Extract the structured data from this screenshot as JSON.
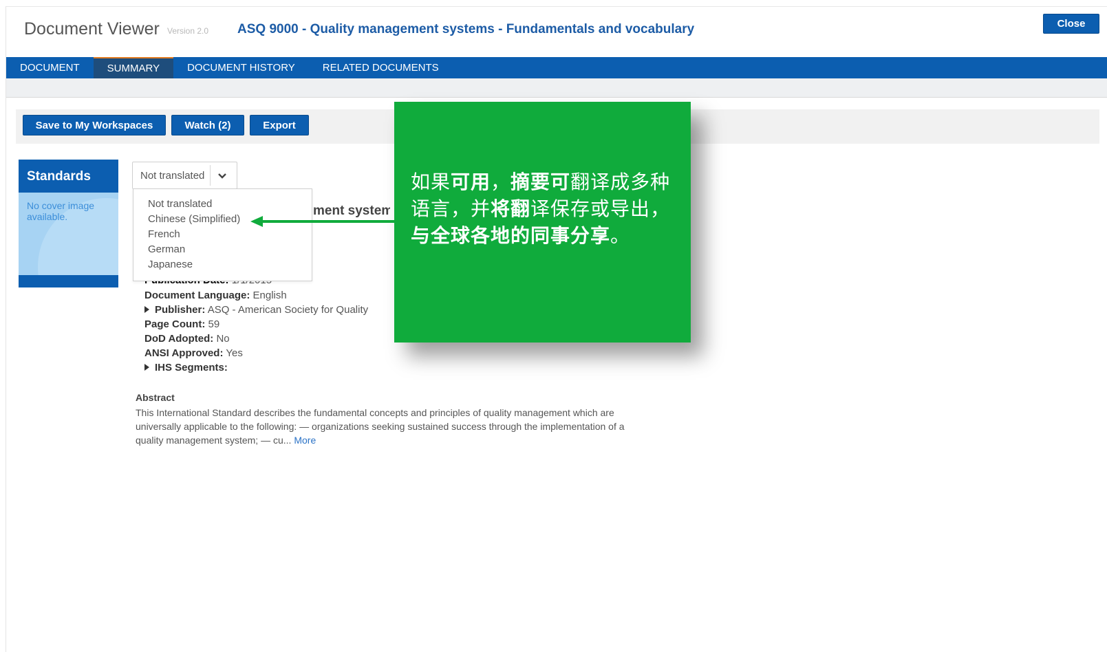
{
  "header": {
    "app_title": "Document Viewer",
    "version": "Version 2.0",
    "doc_title": "ASQ 9000 - Quality management systems - Fundamentals and vocabulary",
    "close_label": "Close"
  },
  "tabs": [
    {
      "label": "DOCUMENT",
      "active": false
    },
    {
      "label": "SUMMARY",
      "active": true
    },
    {
      "label": "DOCUMENT HISTORY",
      "active": false
    },
    {
      "label": "RELATED DOCUMENTS",
      "active": false
    }
  ],
  "actions": {
    "save_label": "Save to My Workspaces",
    "watch_label": "Watch (2)",
    "export_label": "Export"
  },
  "sidebar": {
    "heading": "Standards",
    "cover_note": "No cover image available."
  },
  "translation": {
    "selected": "Not translated",
    "options": [
      "Not translated",
      "Chinese (Simplified)",
      "French",
      "German",
      "Japanese"
    ]
  },
  "partial_title": "ment system",
  "details": {
    "publication_date_label": "Publication Date:",
    "publication_date_value": "1/1/2015",
    "language_label": "Document Language:",
    "language_value": "English",
    "publisher_label": "Publisher:",
    "publisher_value": "ASQ - American Society for Quality",
    "page_count_label": "Page Count:",
    "page_count_value": "59",
    "dod_label": "DoD Adopted:",
    "dod_value": "No",
    "ansi_label": "ANSI Approved:",
    "ansi_value": "Yes",
    "ihs_label": "IHS Segments:"
  },
  "abstract": {
    "label": "Abstract",
    "text": "This International Standard describes the fundamental concepts and principles of quality management which are universally applicable to the following: — organizations seeking sustained success through the implementation of a quality management system; — cu...",
    "more_label": "More"
  },
  "callout": {
    "segments": [
      {
        "text": "如果",
        "bold": false
      },
      {
        "text": "可用",
        "bold": true
      },
      {
        "text": "，",
        "bold": false
      },
      {
        "text": "摘要可",
        "bold": true
      },
      {
        "text": "翻",
        "bold": false
      },
      {
        "text": "译成多种",
        "bold": false
      },
      {
        "text": "语言，并",
        "bold": false
      },
      {
        "text": "将翻",
        "bold": true
      },
      {
        "text": "译保存或导出，",
        "bold": false
      },
      {
        "text": "与全球各地的同事分享",
        "bold": true
      },
      {
        "text": "。",
        "bold": false
      }
    ],
    "color": "#10ab3c"
  },
  "colors": {
    "primary_blue": "#0c5eb0",
    "active_tab": "#1e4d7c",
    "title_blue": "#1d5ca6",
    "sidebar_light": "#a7d3f3",
    "arrow_green": "#10ab3c"
  },
  "icons": [
    "chevron-down-icon",
    "arrow-left-icon",
    "expand-triangle-icon"
  ]
}
